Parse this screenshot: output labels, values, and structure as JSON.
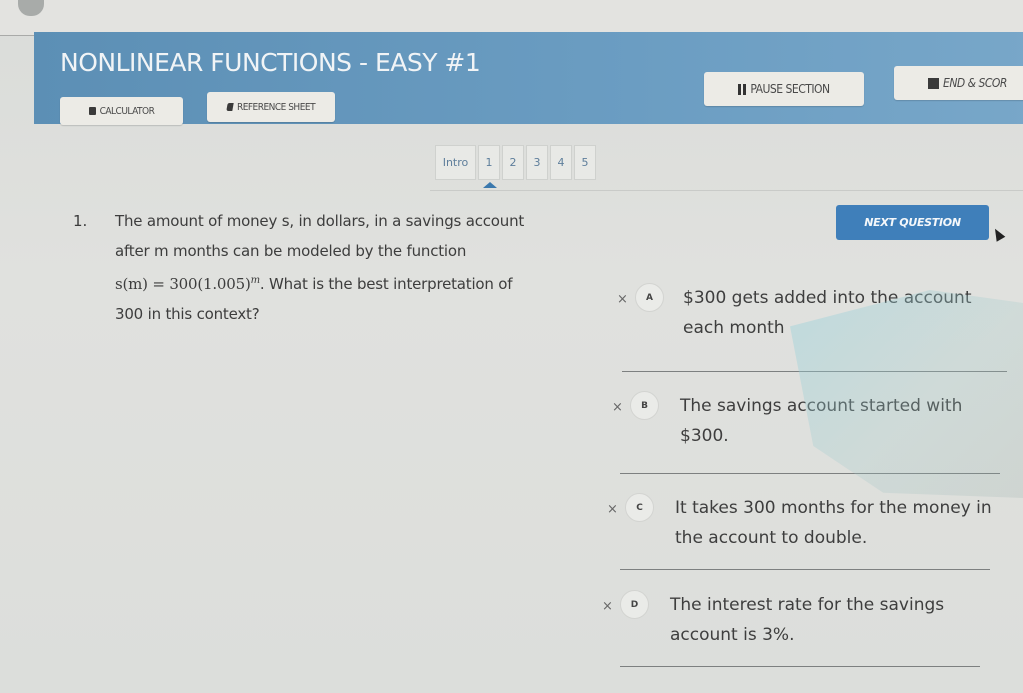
{
  "header": {
    "title": "NONLINEAR FUNCTIONS - EASY #1",
    "calculator_label": "CALCULATOR",
    "reference_label": "REFERENCE SHEET",
    "pause_label": "PAUSE SECTION",
    "end_label": "END & SCOR",
    "accent_color": "#6496bd"
  },
  "nav": {
    "tabs": [
      {
        "label": "Intro"
      },
      {
        "label": "1",
        "current": true
      },
      {
        "label": "2"
      },
      {
        "label": "3"
      },
      {
        "label": "4"
      },
      {
        "label": "5"
      }
    ]
  },
  "question": {
    "number": "1.",
    "line1": "The amount of money s, in dollars, in a savings account",
    "line2": "after m months can be modeled by the function",
    "formula": "s(m) = 300(1.005)",
    "exponent": "m",
    "line3_rest": ". What is the best interpretation of",
    "line4": "300 in this context?"
  },
  "next_button": {
    "label": "NEXT QUESTION",
    "color": "#3f7fba"
  },
  "choices": [
    {
      "letter": "A",
      "mark": "×",
      "text": "$300 gets added into the account each month"
    },
    {
      "letter": "B",
      "mark": "×",
      "text": "The savings account started with $300."
    },
    {
      "letter": "C",
      "mark": "×",
      "text": "It takes 300 months for the money in the account to double."
    },
    {
      "letter": "D",
      "mark": "×",
      "text": "The interest rate for the savings account is 3%."
    }
  ]
}
